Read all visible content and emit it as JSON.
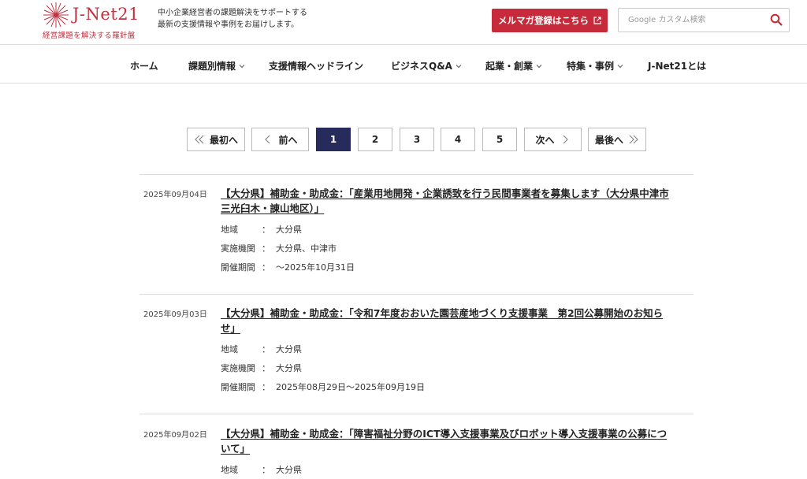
{
  "header": {
    "logo_text": "J-Net21",
    "logo_tagline": "経営課題を解決する羅針盤",
    "tagline_line1": "中小企業経営者の課題解決をサポートする",
    "tagline_line2": "最新の支援情報や事例をお届けします。",
    "newsletter_button": "メルマガ登録はこちら",
    "search_placeholder": "Google カスタム検索",
    "accent_color": "#c72a3a"
  },
  "nav": {
    "items": [
      {
        "label": "ホーム"
      },
      {
        "label": "課題別情報"
      },
      {
        "label": "支援情報ヘッドライン"
      },
      {
        "label": "ビジネスQ&A"
      },
      {
        "label": "起業・創業"
      },
      {
        "label": "特集・事例"
      },
      {
        "label": "J-Net21とは"
      }
    ]
  },
  "pagination": {
    "first": "最初へ",
    "prev": "前へ",
    "pages": [
      "1",
      "2",
      "3",
      "4",
      "5"
    ],
    "current": "1",
    "next": "次へ",
    "last": "最後へ",
    "active_color": "#262b5b"
  },
  "labels": {
    "region": "地域",
    "organization": "実施機関",
    "period": "開催期間",
    "sep": "："
  },
  "entries": [
    {
      "date": "2025年09月04日",
      "title": "【大分県】補助金・助成金：「産業用地開発・企業誘致を行う民間事業者を募集します（大分県中津市三光臼木・諌山地区）」",
      "region": "大分県",
      "organization": "大分県、中津市",
      "period": "〜2025年10月31日"
    },
    {
      "date": "2025年09月03日",
      "title": "【大分県】補助金・助成金：「令和7年度おおいた園芸産地づくり支援事業　第2回公募開始のお知らせ」",
      "region": "大分県",
      "organization": "大分県",
      "period": "2025年08月29日〜2025年09月19日"
    },
    {
      "date": "2025年09月02日",
      "title": "【大分県】補助金・助成金：「障害福祉分野のICT導入支援事業及びロボット導入支援事業の公募について」",
      "region": "大分県"
    }
  ]
}
